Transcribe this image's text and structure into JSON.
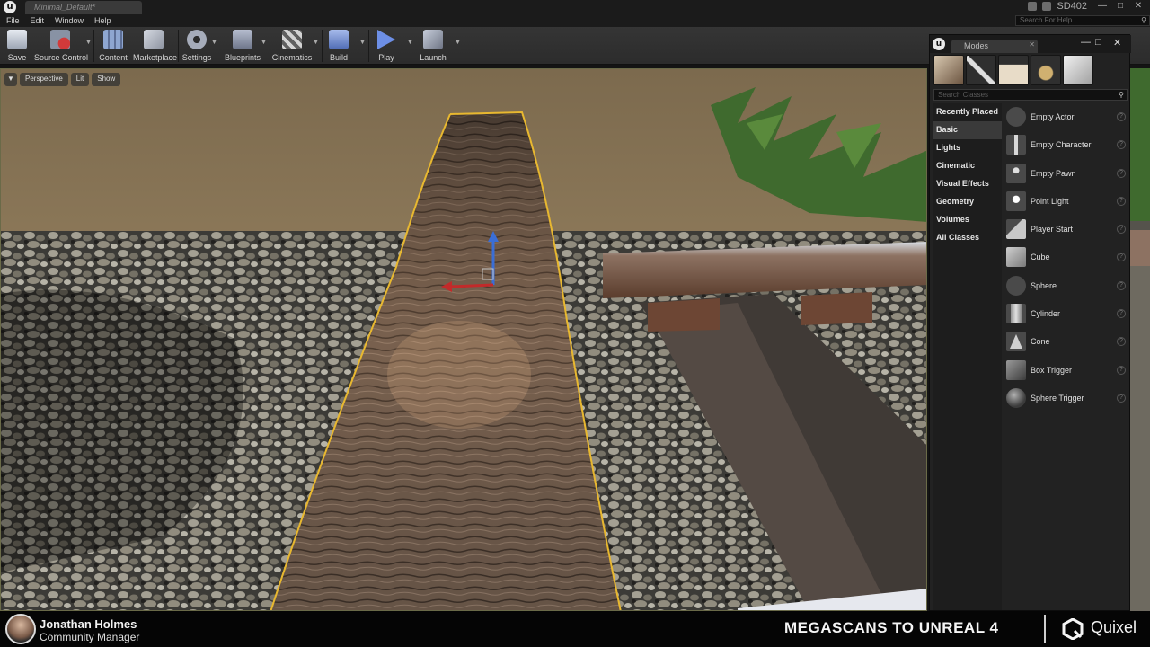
{
  "titlebar": {
    "doc_tab": "Minimal_Default*",
    "project": "SD402"
  },
  "menu": [
    "File",
    "Edit",
    "Window",
    "Help"
  ],
  "search_help": {
    "placeholder": "Search For Help"
  },
  "toolbar": {
    "items": [
      {
        "label": "Save",
        "icon": "save-icon",
        "color": "#cfd6e0"
      },
      {
        "label": "Source Control",
        "icon": "source-control-icon",
        "color": "#9aa4b4"
      },
      {
        "label": "Content",
        "icon": "content-icon",
        "color": "#8ea6d0"
      },
      {
        "label": "Marketplace",
        "icon": "marketplace-icon",
        "color": "#b8bcc6"
      },
      {
        "label": "Settings",
        "icon": "settings-icon",
        "color": "#9aa0b0"
      },
      {
        "label": "Blueprints",
        "icon": "blueprints-icon",
        "color": "#a9b0c4"
      },
      {
        "label": "Cinematics",
        "icon": "cinematics-icon",
        "color": "#c4c4c4"
      },
      {
        "label": "Build",
        "icon": "build-icon",
        "color": "#8aa0d8"
      },
      {
        "label": "Play",
        "icon": "play-icon",
        "color": "#6d8fe6"
      },
      {
        "label": "Launch",
        "icon": "launch-icon",
        "color": "#b0b8c8"
      }
    ]
  },
  "viewport": {
    "perspective": "Perspective",
    "lit": "Lit",
    "show": "Show"
  },
  "modes": {
    "tab_label": "Modes",
    "search_placeholder": "Search Classes",
    "categories": [
      "Recently Placed",
      "Basic",
      "Lights",
      "Cinematic",
      "Visual Effects",
      "Geometry",
      "Volumes",
      "All Classes"
    ],
    "selected_category": "Basic",
    "items": [
      "Empty Actor",
      "Empty Character",
      "Empty Pawn",
      "Point Light",
      "Player Start",
      "Cube",
      "Sphere",
      "Cylinder",
      "Cone",
      "Box Trigger",
      "Sphere Trigger"
    ]
  },
  "lower_third": {
    "name": "Jonathan Holmes",
    "role": "Community Manager",
    "title": "MEGASCANS TO UNREAL 4",
    "brand": "Quixel"
  },
  "colors": {
    "selection_outline": "#e8b830",
    "panel_bg": "#222222",
    "toolbar_bg": "#303030"
  }
}
